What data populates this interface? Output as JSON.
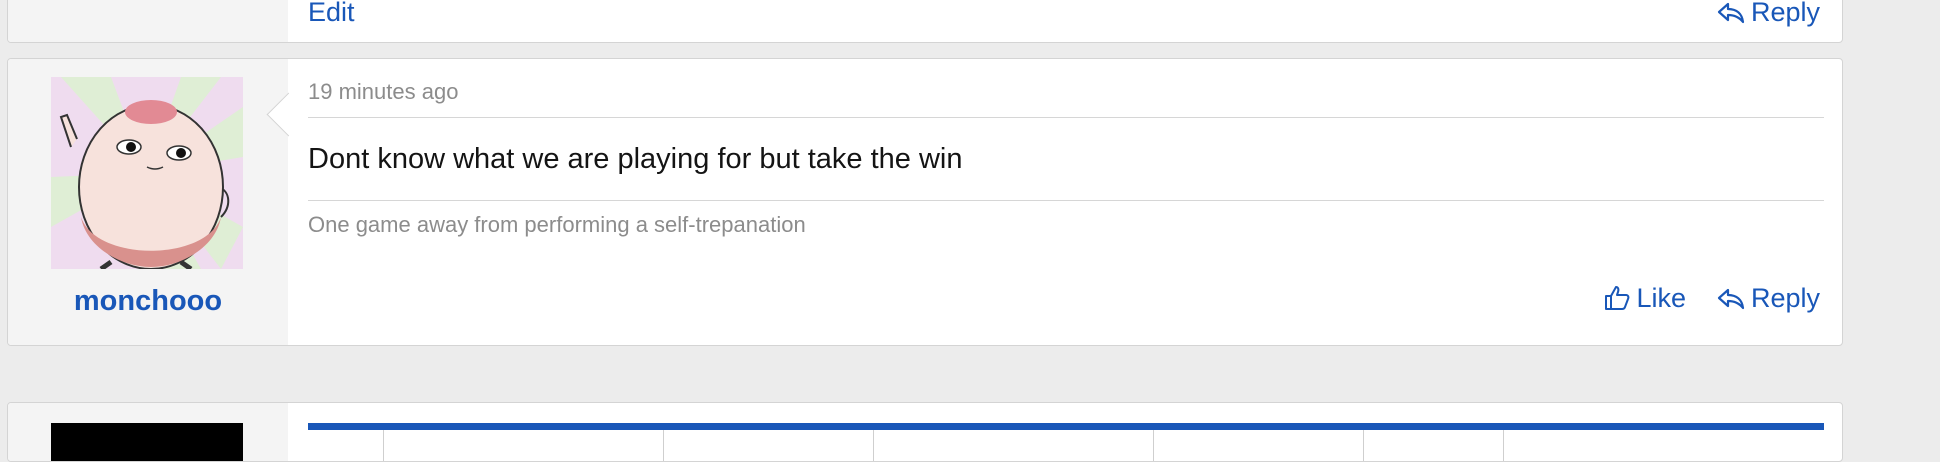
{
  "previous_post": {
    "edit_label": "Edit",
    "reply_label": "Reply"
  },
  "post": {
    "username": "monchooo",
    "timestamp": "19 minutes ago",
    "message": "Dont know what we are playing for but take the win",
    "signature": "One game away from performing a self-trepanation",
    "like_label": "Like",
    "reply_label": "Reply",
    "avatar_icon": "egg-character-avatar"
  },
  "colors": {
    "link": "#1957b8",
    "background": "#ececec",
    "card": "#ffffff",
    "user_column": "#f4f4f4",
    "muted_text": "#8c8c8c"
  }
}
